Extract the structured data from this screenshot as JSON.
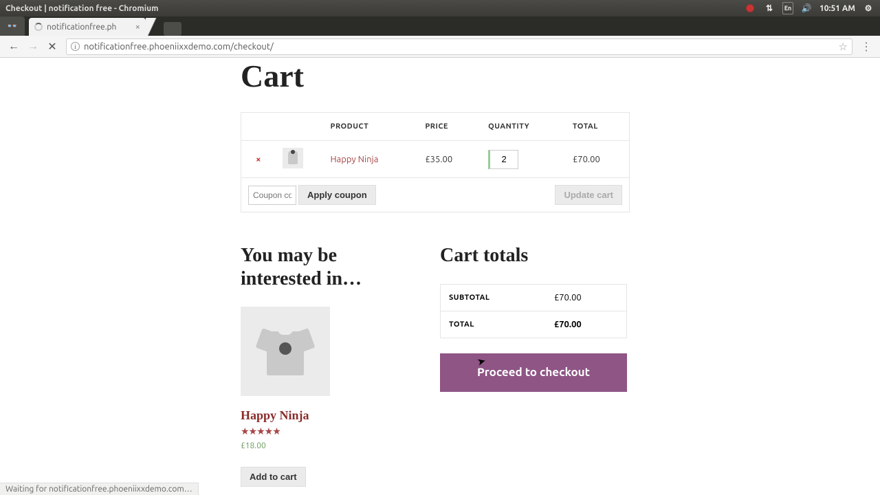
{
  "titlebar": {
    "text": "Checkout | notification free - Chromium",
    "time": "10:51 AM",
    "lang": "En"
  },
  "tab": {
    "label": "notificationfree.ph"
  },
  "url": "notificationfree.phoeniixxdemo.com/checkout/",
  "page_title": "Cart",
  "cart": {
    "headers": {
      "product": "PRODUCT",
      "price": "PRICE",
      "qty": "QUANTITY",
      "total": "TOTAL"
    },
    "item": {
      "name": "Happy Ninja",
      "price": "£35.00",
      "qty": "2",
      "total": "£70.00"
    },
    "coupon_placeholder": "Coupon code",
    "apply": "Apply coupon",
    "update": "Update cart"
  },
  "interest": {
    "heading": "You may be interested in…",
    "product": {
      "name": "Happy Ninja",
      "stars": "★★★★★",
      "price": "£18.00",
      "add": "Add to cart"
    }
  },
  "totals": {
    "heading": "Cart totals",
    "subtotal_label": "SUBTOTAL",
    "subtotal": "£70.00",
    "total_label": "TOTAL",
    "total": "£70.00",
    "checkout": "Proceed to checkout"
  },
  "status": "Waiting for notificationfree.phoeniixxdemo.com…"
}
